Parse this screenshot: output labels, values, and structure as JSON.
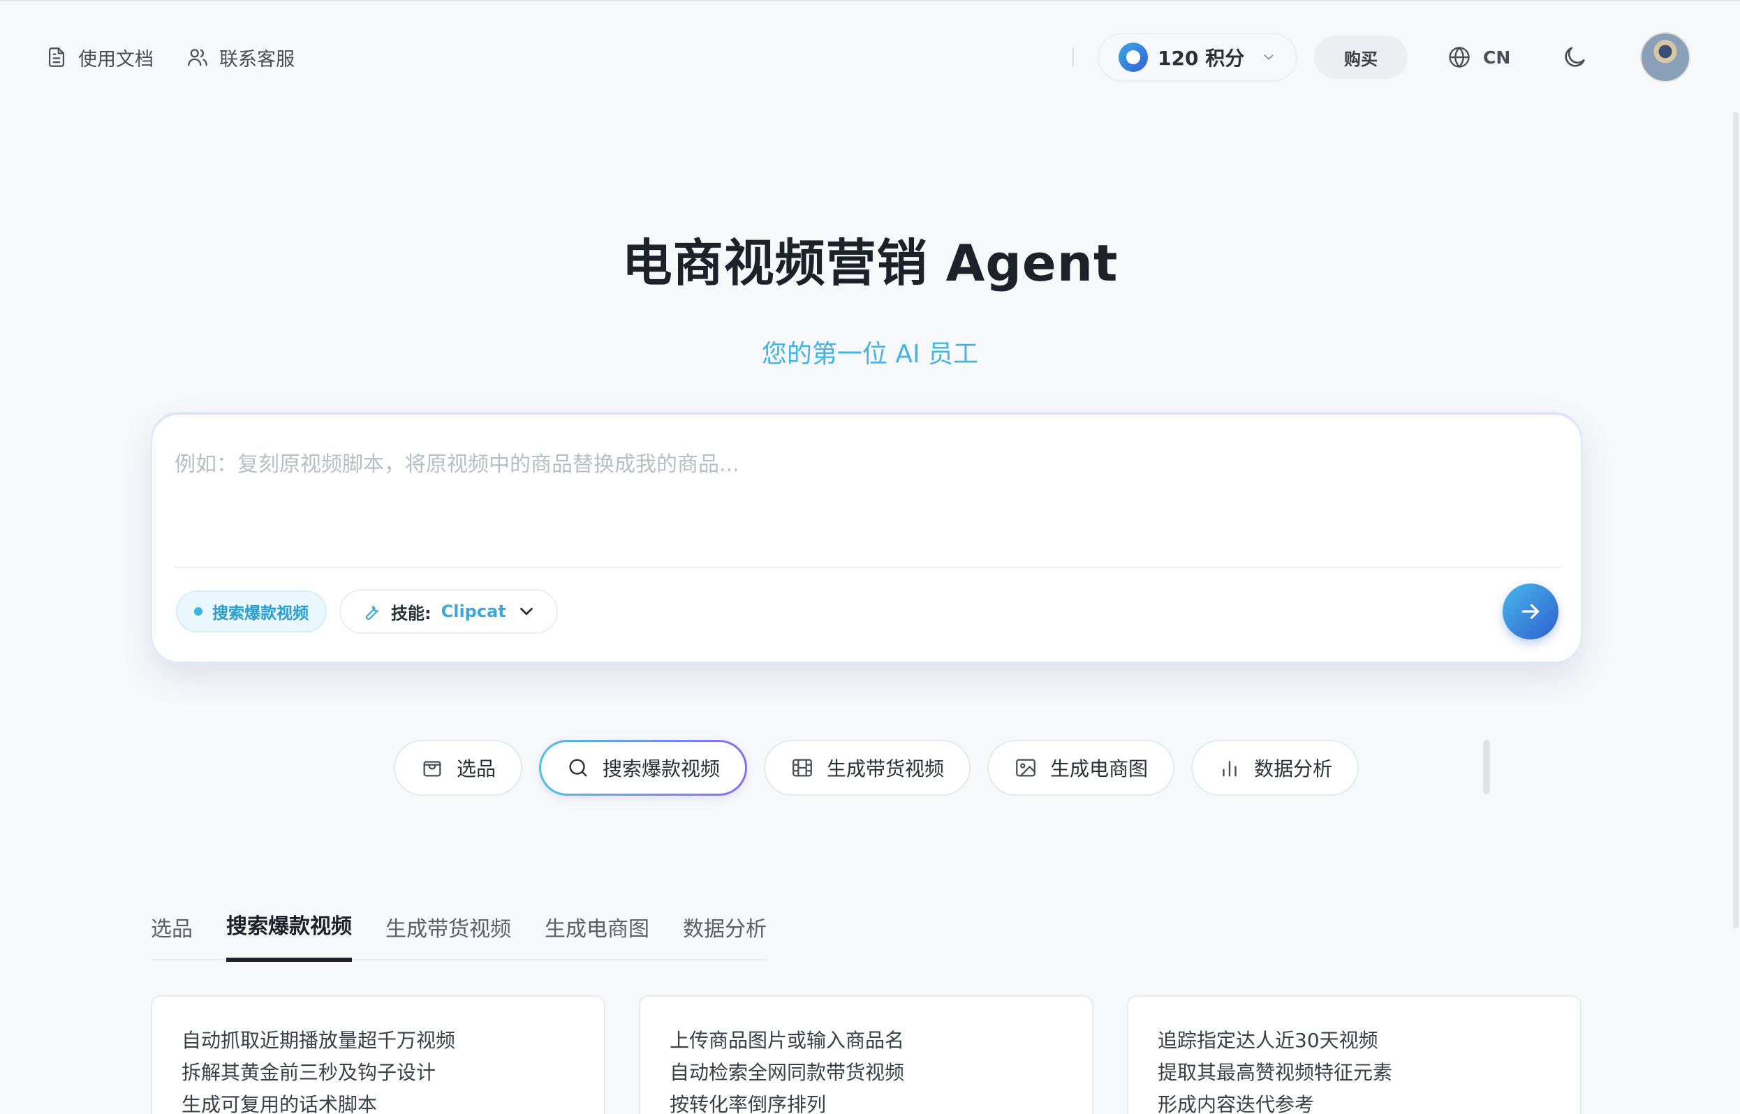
{
  "header": {
    "docs_label": "使用文档",
    "support_label": "联系客服",
    "points_label": "120 积分",
    "buy_label": "购买",
    "lang_label": "CN"
  },
  "hero": {
    "title": "电商视频营销 Agent",
    "subtitle": "您的第一位 AI 员工"
  },
  "composer": {
    "placeholder": "例如：复刻原视频脚本，将原视频中的商品替换成我的商品...",
    "mode_chip": "搜索爆款视频",
    "skill_label": "技能:",
    "skill_value": "Clipcat"
  },
  "quick_actions": [
    {
      "label": "选品",
      "icon": "shopping-bag-icon"
    },
    {
      "label": "搜索爆款视频",
      "icon": "search-icon",
      "active": true
    },
    {
      "label": "生成带货视频",
      "icon": "film-icon"
    },
    {
      "label": "生成电商图",
      "icon": "image-icon"
    },
    {
      "label": "数据分析",
      "icon": "bar-chart-icon"
    }
  ],
  "tabs": [
    {
      "label": "选品"
    },
    {
      "label": "搜索爆款视频",
      "active": true
    },
    {
      "label": "生成带货视频"
    },
    {
      "label": "生成电商图"
    },
    {
      "label": "数据分析"
    }
  ],
  "feature_cards": [
    {
      "lines": [
        "自动抓取近期播放量超千万视频",
        "拆解其黄金前三秒及钩子设计",
        "生成可复用的话术脚本"
      ]
    },
    {
      "lines": [
        "上传商品图片或输入商品名",
        "自动检索全网同款带货视频",
        "按转化率倒序排列"
      ]
    },
    {
      "lines": [
        "追踪指定达人近30天视频",
        "提取其最高赞视频特征元素",
        "形成内容迭代参考"
      ]
    }
  ],
  "colors": {
    "accent": "#3aa8e0",
    "subtitle": "#43b4e6",
    "send_gradient_start": "#49b8ea",
    "send_gradient_end": "#2d5ed0",
    "active_border_start": "#4cc1ec",
    "active_border_end": "#8a6cf0"
  }
}
